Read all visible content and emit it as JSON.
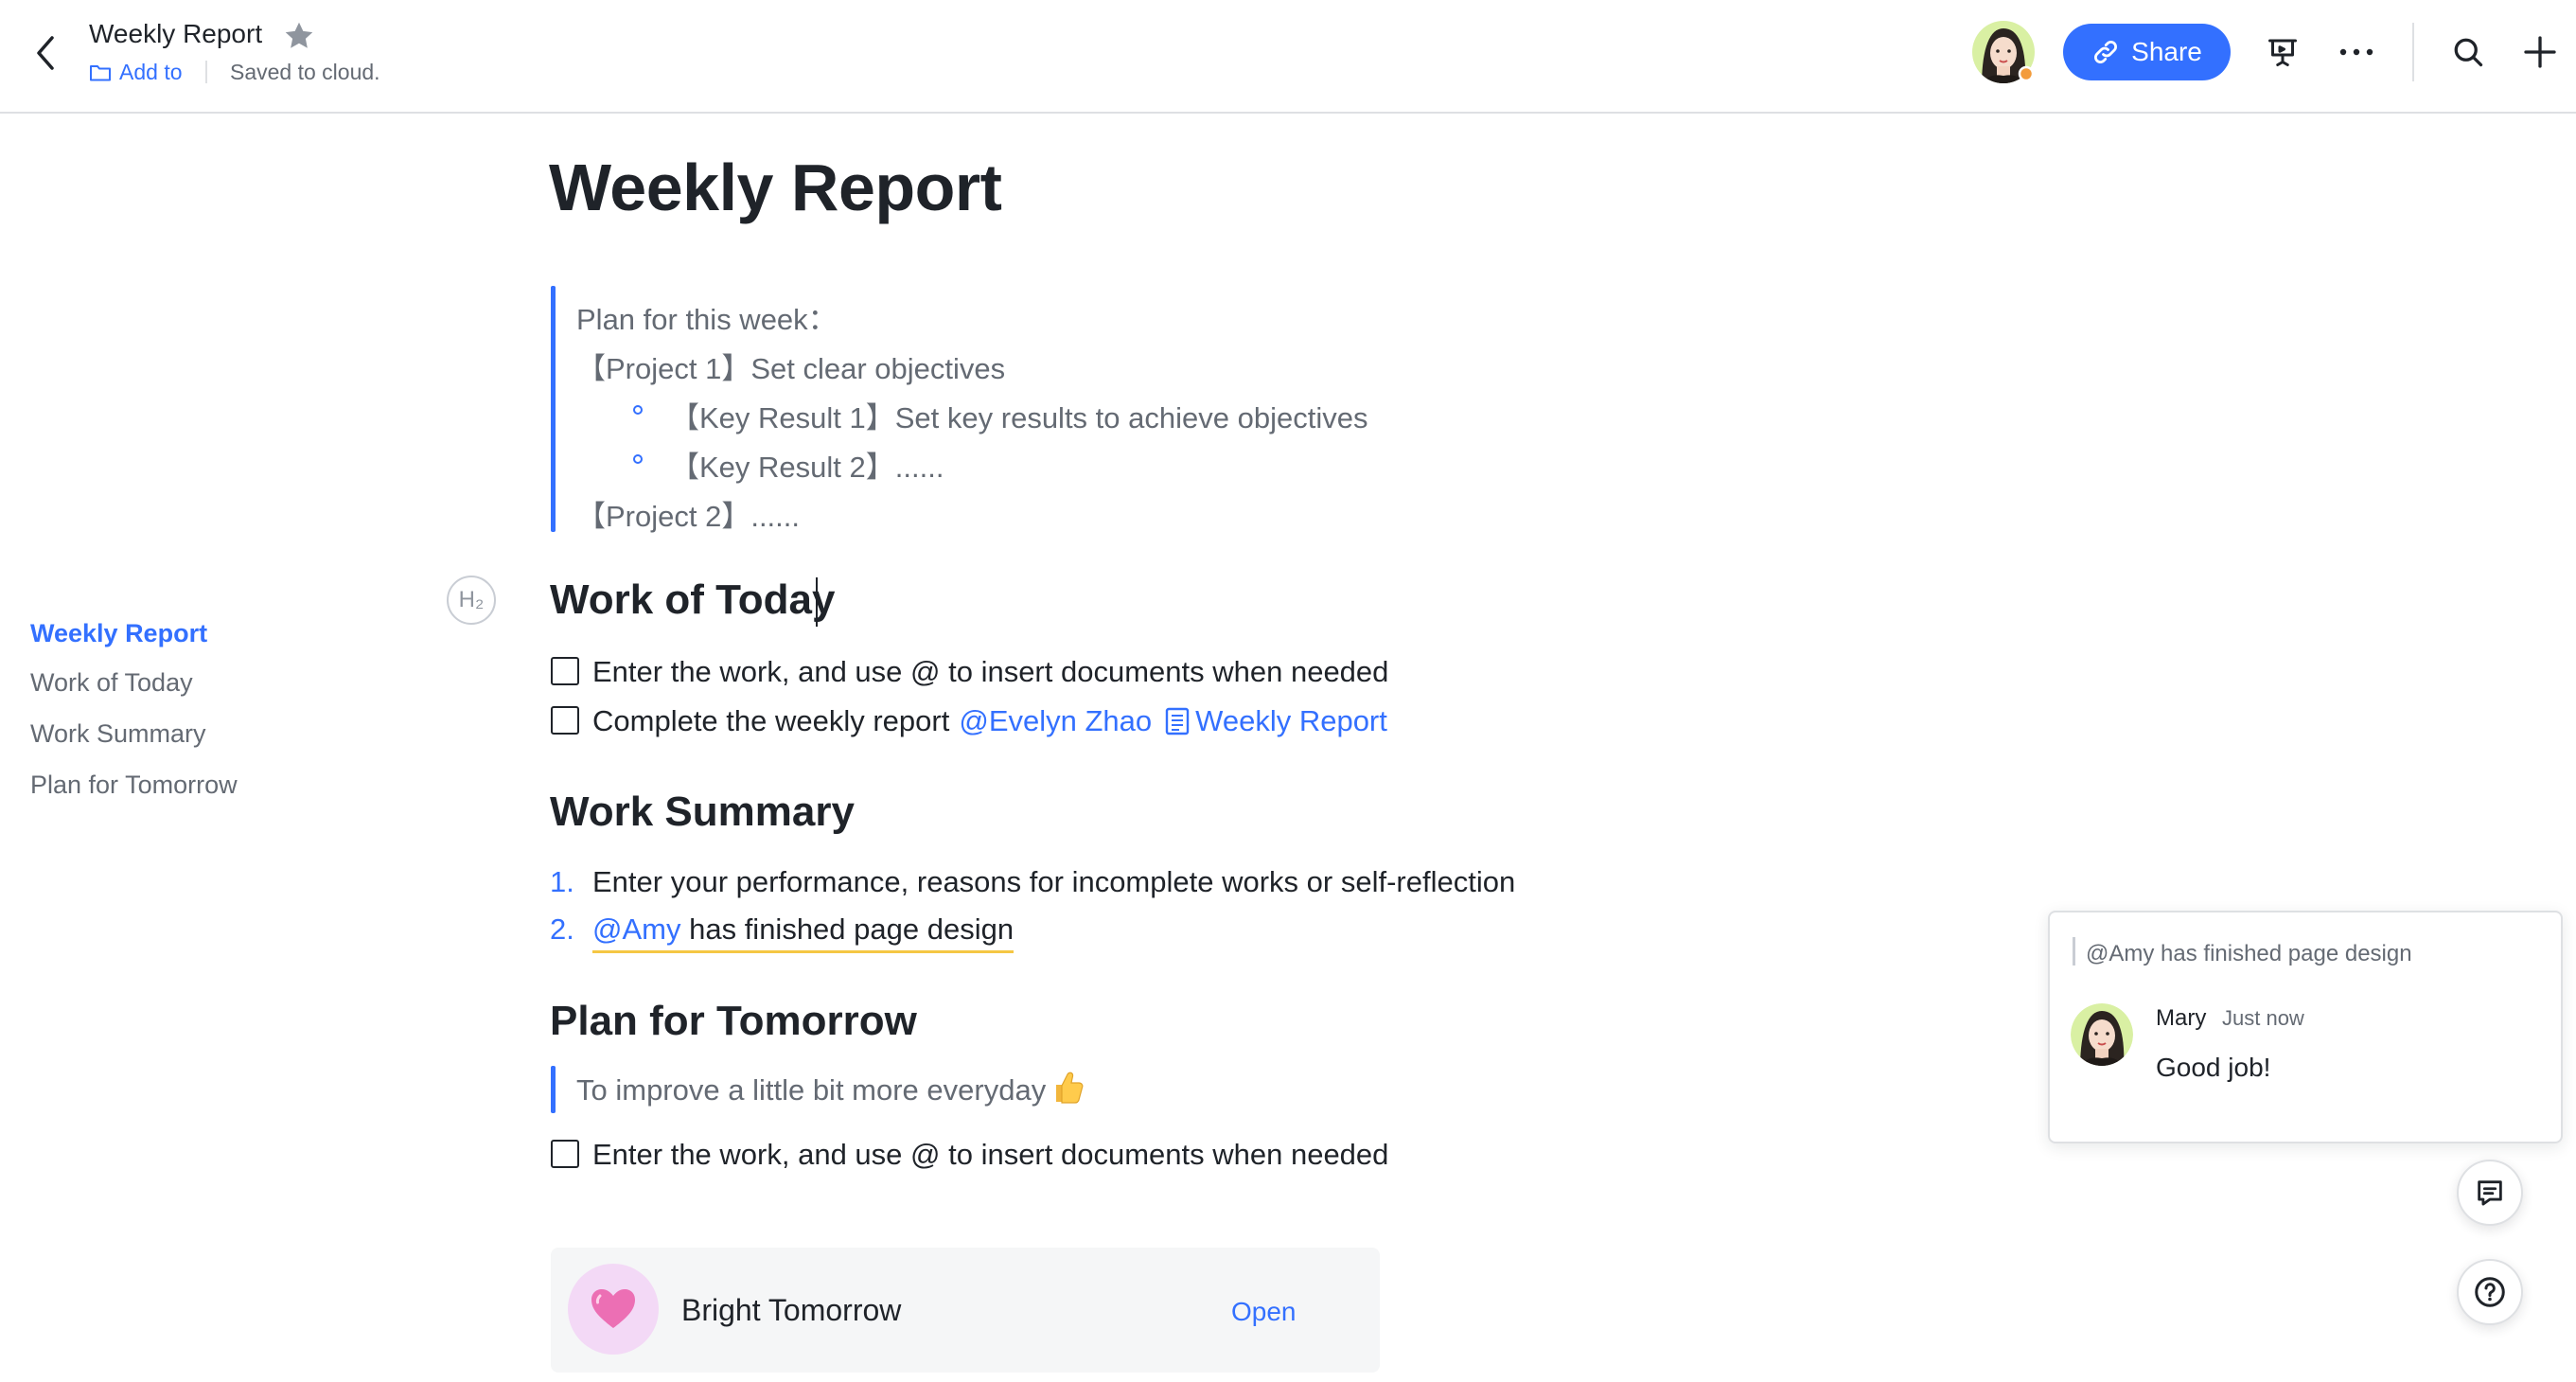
{
  "header": {
    "title": "Weekly Report",
    "add_to": "Add to",
    "status": "Saved to cloud.",
    "share_label": "Share"
  },
  "outline": {
    "items": [
      "Weekly Report",
      "Work of Today",
      "Work Summary",
      "Plan for Tomorrow"
    ],
    "active_index": 0
  },
  "doc": {
    "title": "Weekly Report",
    "plan_quote": {
      "line1": "Plan for this week：",
      "project1": "【Project 1】Set clear objectives",
      "kr1": "【Key Result 1】Set key results to achieve objectives",
      "kr2": "【Key Result 2】......",
      "project2": "【Project 2】......"
    },
    "h2_badge": "H₂",
    "work_today": {
      "heading": "Work of Today",
      "task1": "Enter the work, and use @ to insert documents when needed",
      "task2_text": "Complete the weekly report",
      "task2_mention": "@Evelyn Zhao",
      "task2_doc_link": "Weekly Report"
    },
    "work_summary": {
      "heading": "Work Summary",
      "item1_num": "1.",
      "item1": "Enter your performance, reasons for incomplete works or self-reflection",
      "item2_num": "2.",
      "item2_mention": "@Amy",
      "item2_text": " has finished page design"
    },
    "plan_tomorrow": {
      "heading": "Plan for Tomorrow",
      "quote": "To improve a little bit more everyday",
      "quote_emoji": "thumbs-up",
      "task1": "Enter the work, and use @ to insert documents when needed"
    },
    "card": {
      "title": "Bright Tomorrow",
      "open_label": "Open",
      "icon": "pink-heart"
    }
  },
  "comment": {
    "quote": "@Amy has finished page design",
    "author": "Mary",
    "time": "Just now",
    "body": "Good job!"
  },
  "colors": {
    "accent": "#3370ff",
    "text": "#1f2329",
    "muted": "#646a73",
    "highlight": "#f5c744"
  }
}
